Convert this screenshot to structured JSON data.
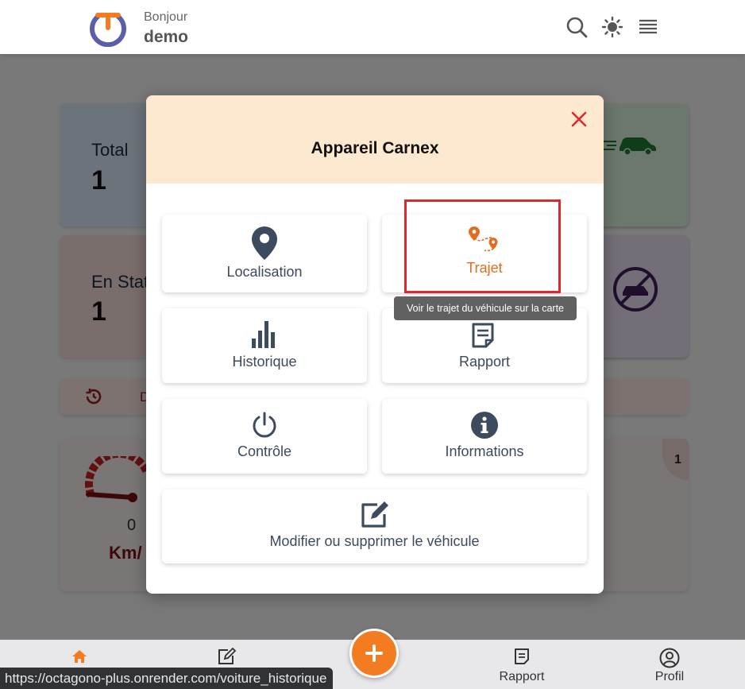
{
  "header": {
    "greeting": "Bonjour",
    "username": "demo",
    "logo_color_ring": "#5b5fa8",
    "logo_color_accent": "#f37b20"
  },
  "background": {
    "total_label": "Total",
    "total_value": "1",
    "station_label": "En Stat",
    "station_value": "1",
    "strip_text": "D",
    "speed_value": "0",
    "speed_unit": "Km/",
    "corner_badge": "1"
  },
  "modal": {
    "title": "Appareil Carnex",
    "tiles": [
      {
        "label": "Localisation",
        "icon": "map-pin-icon"
      },
      {
        "label": "Trajet",
        "icon": "route-icon"
      },
      {
        "label": "Historique",
        "icon": "bar-chart-icon"
      },
      {
        "label": "Rapport",
        "icon": "report-icon"
      },
      {
        "label": "Contrôle",
        "icon": "power-icon"
      },
      {
        "label": "Informations",
        "icon": "info-icon"
      },
      {
        "label": "Modifier ou supprimer le véhicule",
        "icon": "edit-icon"
      }
    ],
    "tooltip": "Voir le trajet du véhicule sur la carte",
    "accent_color": "#e56b1f"
  },
  "bottom_nav": {
    "items": [
      {
        "label": "",
        "icon": "home-icon"
      },
      {
        "label": "",
        "icon": "edit-icon"
      },
      {
        "label": "Rapport",
        "icon": "report-icon"
      },
      {
        "label": "Profil",
        "icon": "user-circle-icon"
      }
    ],
    "fab_icon": "plus-icon"
  },
  "status_url": "https://octagono-plus.onrender.com/voiture_historique"
}
